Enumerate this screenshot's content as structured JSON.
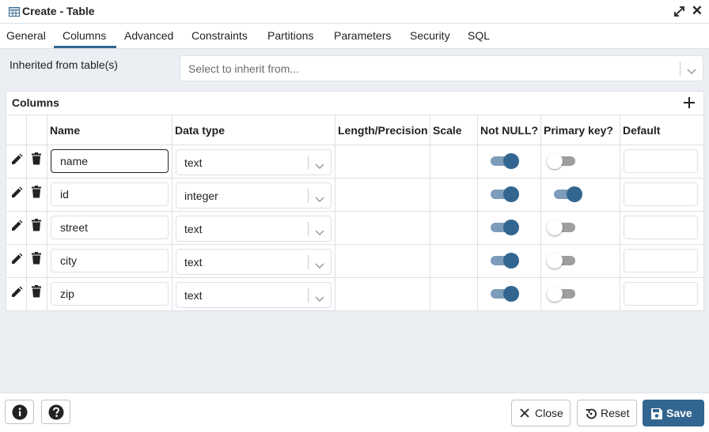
{
  "window": {
    "title": "Create - Table",
    "table_icon": "table-icon",
    "maximize_icon": "maximize-icon",
    "close_icon": "close-icon"
  },
  "tabs": [
    {
      "label": "General",
      "active": false
    },
    {
      "label": "Columns",
      "active": true
    },
    {
      "label": "Advanced",
      "active": false
    },
    {
      "label": "Constraints",
      "active": false
    },
    {
      "label": "Partitions",
      "active": false
    },
    {
      "label": "Parameters",
      "active": false
    },
    {
      "label": "Security",
      "active": false
    },
    {
      "label": "SQL",
      "active": false
    }
  ],
  "inherit": {
    "label": "Inherited from table(s)",
    "placeholder": "Select to inherit from..."
  },
  "columns": {
    "title": "Columns",
    "add_icon": "plus-icon",
    "headers": {
      "name": "Name",
      "data_type": "Data type",
      "length": "Length/Precision",
      "scale": "Scale",
      "not_null": "Not NULL?",
      "primary_key": "Primary key?",
      "default": "Default"
    },
    "rows": [
      {
        "name": "name",
        "data_type": "text",
        "not_null": true,
        "primary_key": false,
        "focused": true
      },
      {
        "name": "id",
        "data_type": "integer",
        "not_null": true,
        "primary_key": true,
        "focused": false
      },
      {
        "name": "street",
        "data_type": "text",
        "not_null": true,
        "primary_key": false,
        "focused": false
      },
      {
        "name": "city",
        "data_type": "text",
        "not_null": true,
        "primary_key": false,
        "focused": false
      },
      {
        "name": "zip",
        "data_type": "text",
        "not_null": true,
        "primary_key": false,
        "focused": false
      }
    ]
  },
  "footer": {
    "info_icon": "info-icon",
    "help_icon": "help-icon",
    "close_label": "Close",
    "reset_label": "Reset",
    "save_label": "Save"
  },
  "colors": {
    "accent": "#326690",
    "toggle_on_track": "#7d9cba",
    "panel_bg": "#ebeef3"
  }
}
